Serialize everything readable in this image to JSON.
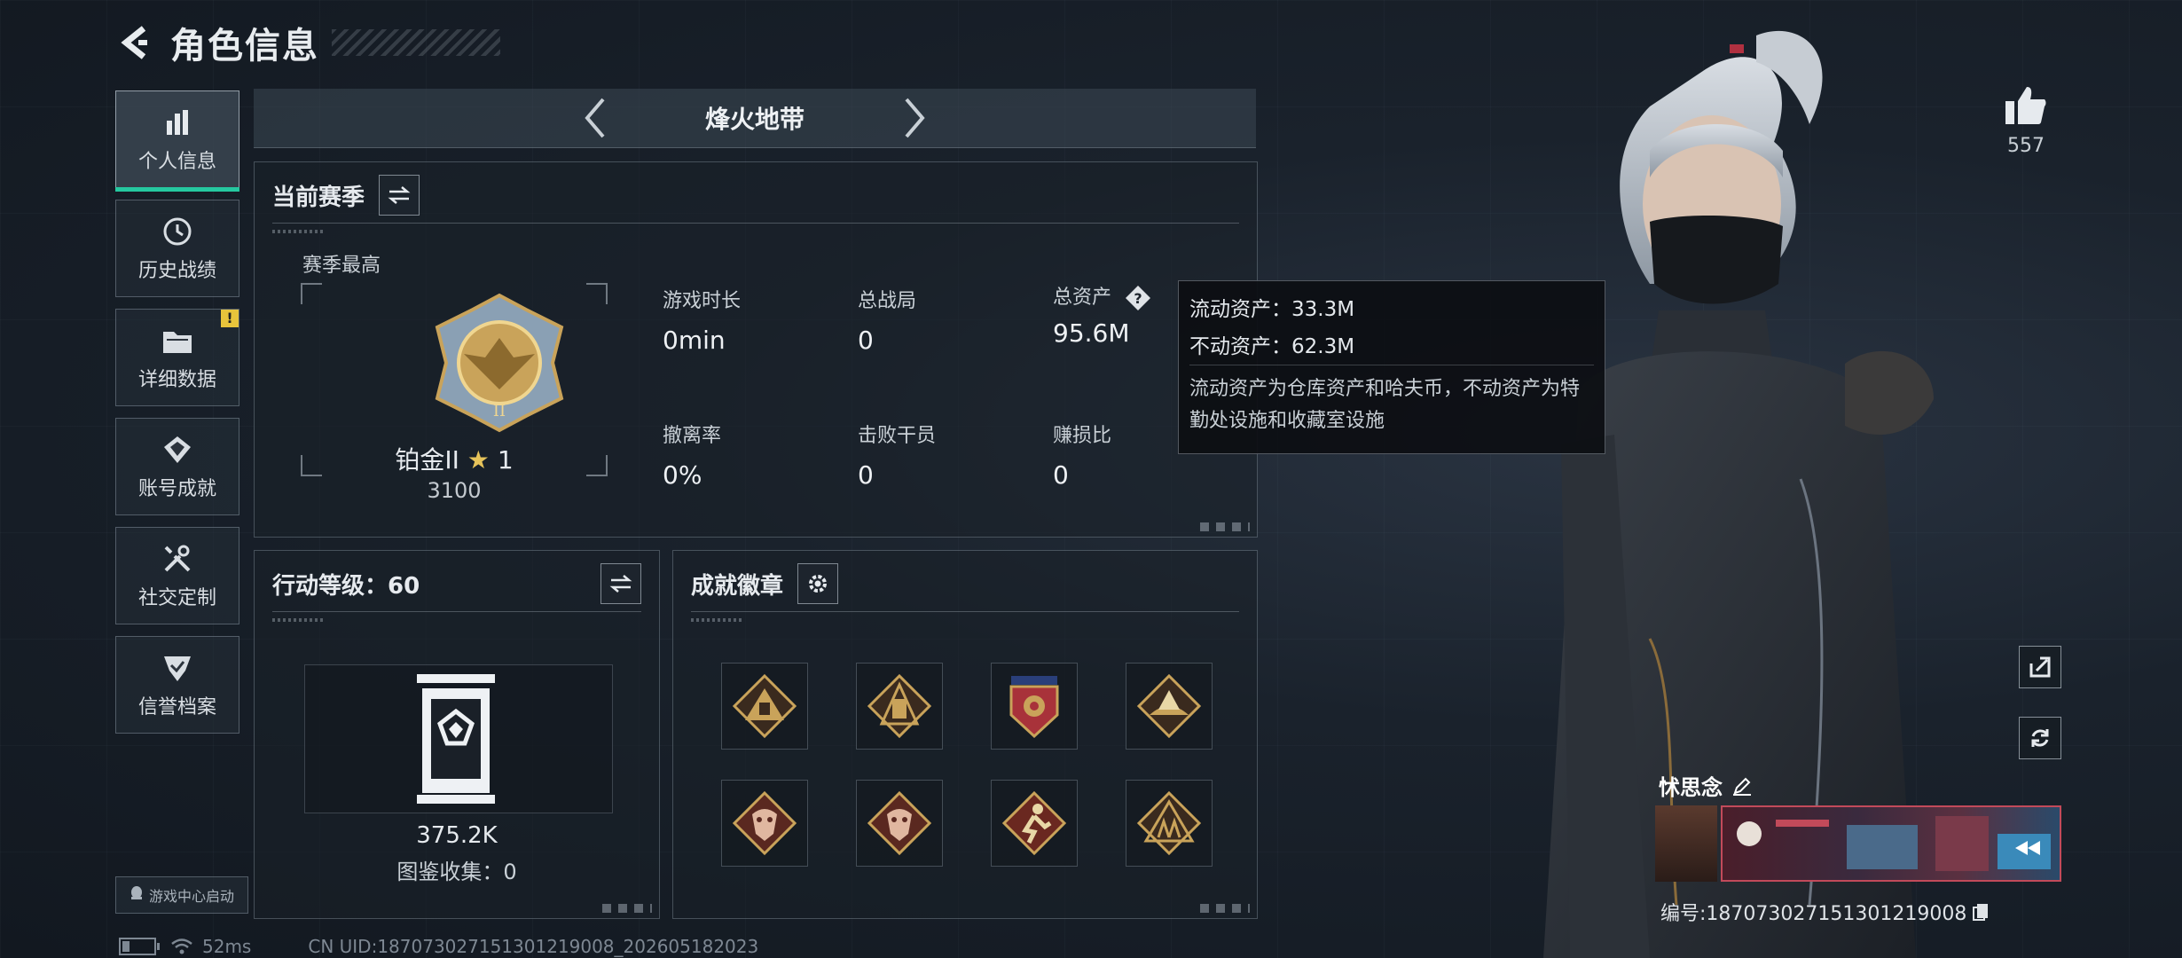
{
  "header": {
    "title": "角色信息"
  },
  "sidebar": {
    "items": [
      {
        "label": "个人信息",
        "icon": "bar-chart-icon",
        "active": true
      },
      {
        "label": "历史战绩",
        "icon": "history-icon"
      },
      {
        "label": "详细数据",
        "icon": "folder-icon",
        "badge": "!"
      },
      {
        "label": "账号成就",
        "icon": "achievement-icon"
      },
      {
        "label": "社交定制",
        "icon": "tools-icon"
      },
      {
        "label": "信誉档案",
        "icon": "shield-check-icon"
      }
    ],
    "game_center": "游戏中心启动"
  },
  "mode": {
    "name": "烽火地带"
  },
  "season": {
    "title": "当前赛季",
    "best_label": "赛季最高",
    "rank_name": "铂金II",
    "rank_stars": "1",
    "rank_score": "3100",
    "stats": [
      {
        "label": "游戏时长",
        "value": "0min"
      },
      {
        "label": "总战局",
        "value": "0"
      },
      {
        "label": "总资产",
        "value": "95.6M"
      },
      {
        "label": "撤离率",
        "value": "0%"
      },
      {
        "label": "击败干员",
        "value": "0"
      },
      {
        "label": "赚损比",
        "value": "0"
      }
    ]
  },
  "tooltip": {
    "liquid": "流动资产：33.3M",
    "fixed": "不动资产：62.3M",
    "description": "流动资产为仓库资产和哈夫币，不动资产为特勤处设施和收藏室设施"
  },
  "level": {
    "title": "行动等级：60",
    "value": "375.2K",
    "collection": "图鉴收集：0"
  },
  "achievements": {
    "title": "成就徽章",
    "badges": [
      "badge-1",
      "badge-2",
      "badge-3",
      "badge-4",
      "badge-5",
      "badge-6",
      "badge-7",
      "badge-8"
    ]
  },
  "likes": {
    "count": "557"
  },
  "player": {
    "name": "怵思念",
    "uid": "编号:187073027151301219008"
  },
  "status": {
    "ping": "52ms",
    "cn_uid": "CN UID:187073027151301219008_202605182023"
  },
  "colors": {
    "accent": "#25c8a0",
    "warning": "#e8c43b",
    "gold": "#c9a35a"
  }
}
